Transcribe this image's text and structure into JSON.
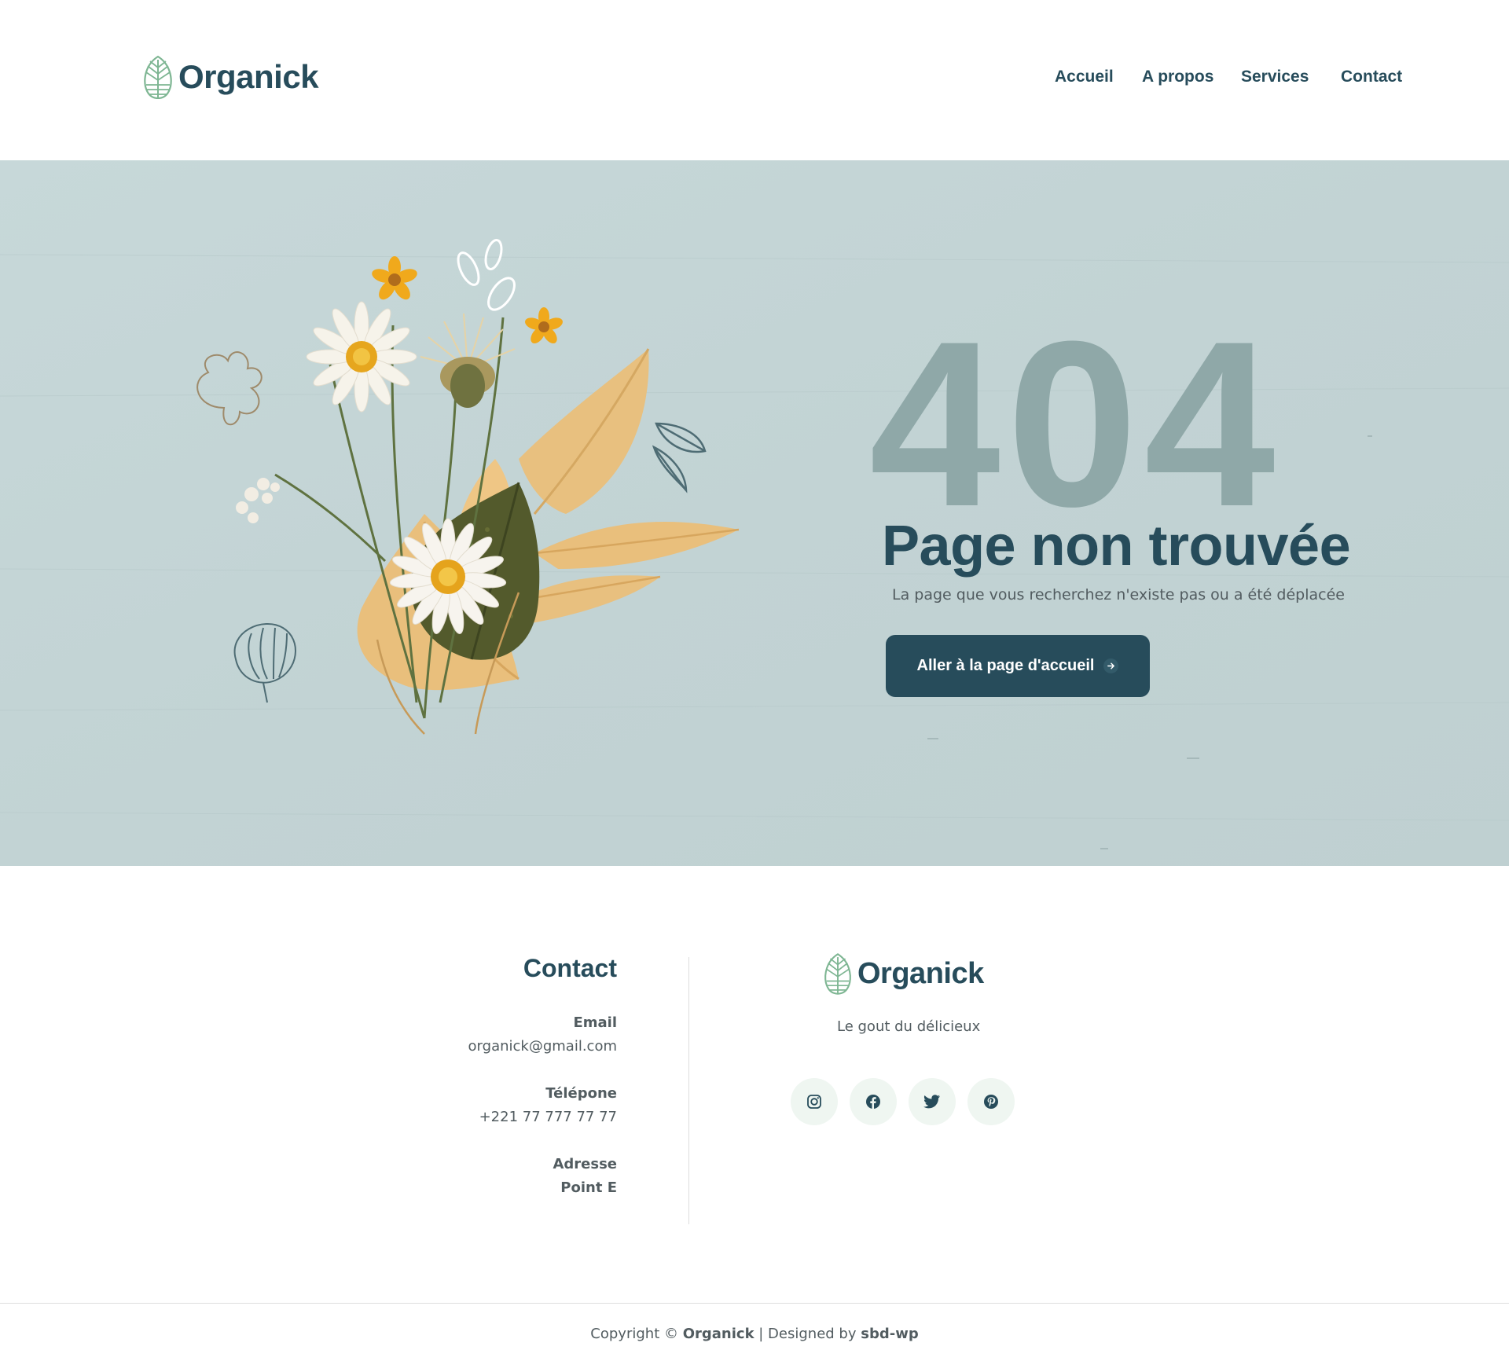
{
  "brand": {
    "name": "Organick",
    "primary_color": "#274c5b",
    "accent_color": "#7eb693",
    "logo_icon": "leaf-icon"
  },
  "nav": {
    "items": [
      {
        "label": "Accueil"
      },
      {
        "label": "A propos"
      },
      {
        "label": "Services"
      },
      {
        "label": "Contact"
      }
    ]
  },
  "hero": {
    "code": "404",
    "title": "Page non trouvée",
    "subtitle": "La page que vous recherchez n'existe pas ou a été déplacée",
    "button_label": "Aller à la page d'accueil",
    "button_icon": "arrow-right-icon",
    "background_color": "#c5d6d7"
  },
  "footer": {
    "contact_title": "Contact",
    "email_label": "Email",
    "email_value": "organick@gmail.com",
    "phone_label": "Télépone",
    "phone_value": "+221 77 777 77 77",
    "address_label": "Adresse",
    "address_value": "Point E",
    "tagline": "Le gout du délicieux",
    "socials": [
      {
        "icon": "instagram-icon"
      },
      {
        "icon": "facebook-icon"
      },
      {
        "icon": "twitter-icon"
      },
      {
        "icon": "pinterest-icon"
      }
    ],
    "copyright_prefix": "Copyright © ",
    "copyright_brand": "Organick",
    "copyright_middle": " | Designed by ",
    "copyright_designer": "sbd-wp"
  }
}
